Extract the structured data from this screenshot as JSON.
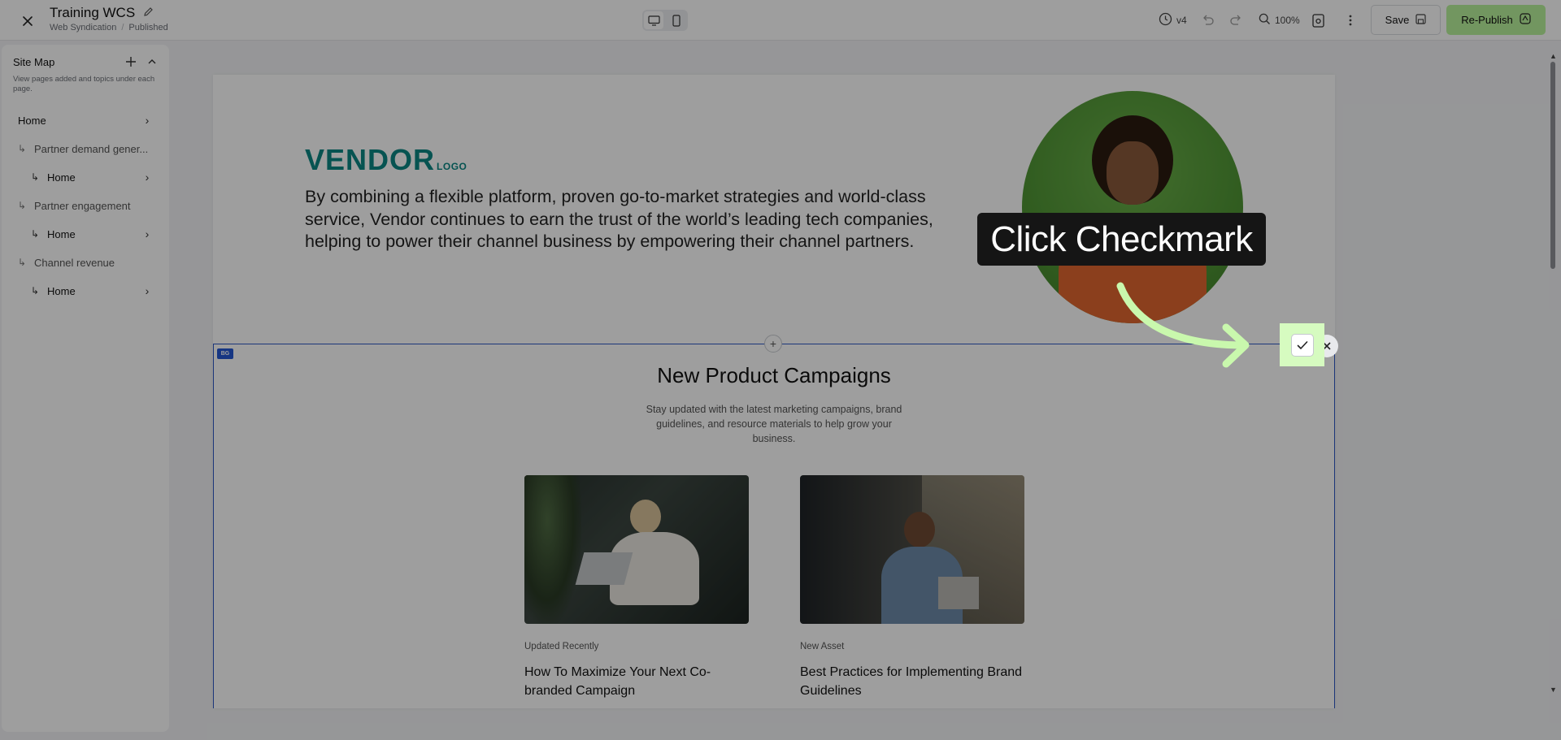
{
  "app": {
    "title": "Training WCS",
    "breadcrumb": [
      "Web Syndication",
      "/",
      "Published"
    ]
  },
  "toolbar": {
    "version": "v4",
    "zoom": "100%",
    "save_label": "Save",
    "publish_label": "Re-Publish",
    "publish_color": "#b9f29b"
  },
  "sitemap": {
    "title": "Site Map",
    "description": "View pages added and topics under each page.",
    "items": [
      {
        "label": "Home",
        "level": 0
      },
      {
        "label": "Partner demand gener...",
        "level": 1
      },
      {
        "label": "Home",
        "level": 2
      },
      {
        "label": "Partner engagement",
        "level": 1
      },
      {
        "label": "Home",
        "level": 2
      },
      {
        "label": "Channel revenue",
        "level": 1
      },
      {
        "label": "Home",
        "level": 2
      }
    ]
  },
  "hero": {
    "logo_main": "VENDOR",
    "logo_small": "LOGO",
    "logo_color": "#0b8784",
    "text": "By combining a flexible platform, proven go-to-market strategies and world-class service, Vendor continues to earn the trust of the world’s leading tech companies, helping to power their channel business by empowering their channel partners."
  },
  "section": {
    "tag": "BG",
    "title": "New Product Campaigns",
    "subtitle": "Stay updated with the latest marketing campaigns, brand guidelines, and resource materials to help grow your business.",
    "cards": [
      {
        "tag": "Updated Recently",
        "title": "How To Maximize Your Next Co-branded Campaign"
      },
      {
        "tag": "New Asset",
        "title": "Best Practices for Implementing Brand Guidelines"
      }
    ]
  },
  "guide": {
    "tooltip": "Click Checkmark",
    "highlight_color": "#d6fbc0"
  }
}
